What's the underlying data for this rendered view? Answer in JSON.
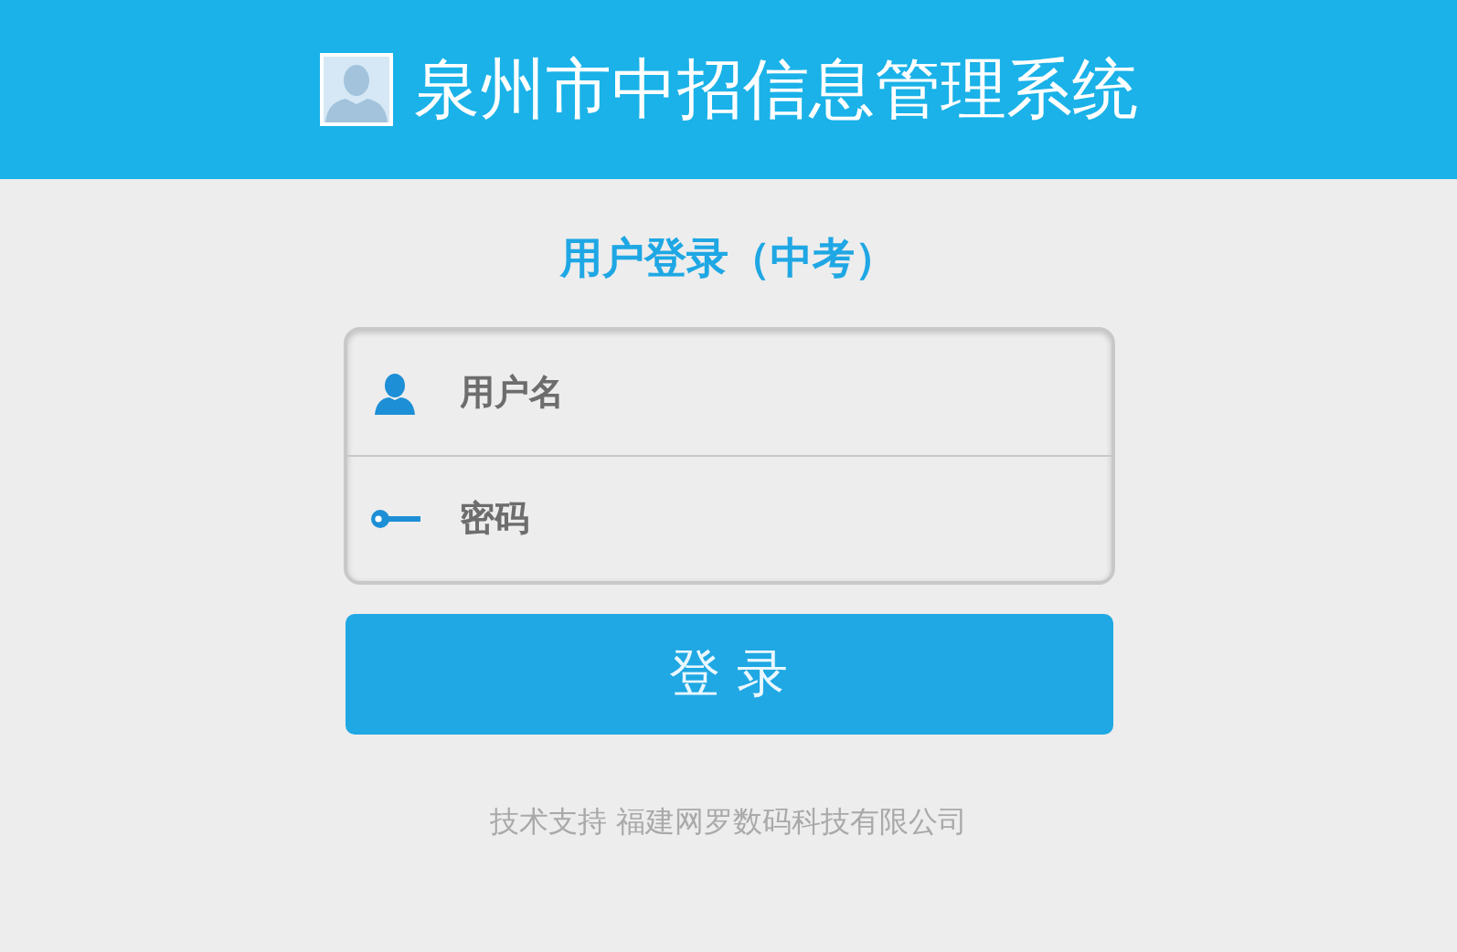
{
  "header": {
    "title": "泉州市中招信息管理系统"
  },
  "login": {
    "heading": "用户登录（中考）",
    "fields": [
      {
        "kind": "user",
        "placeholder": "用户名"
      },
      {
        "kind": "password",
        "placeholder": "密码"
      }
    ],
    "submit": "登 录"
  },
  "footer": "技术支持 福建网罗数码科技有限公司"
}
